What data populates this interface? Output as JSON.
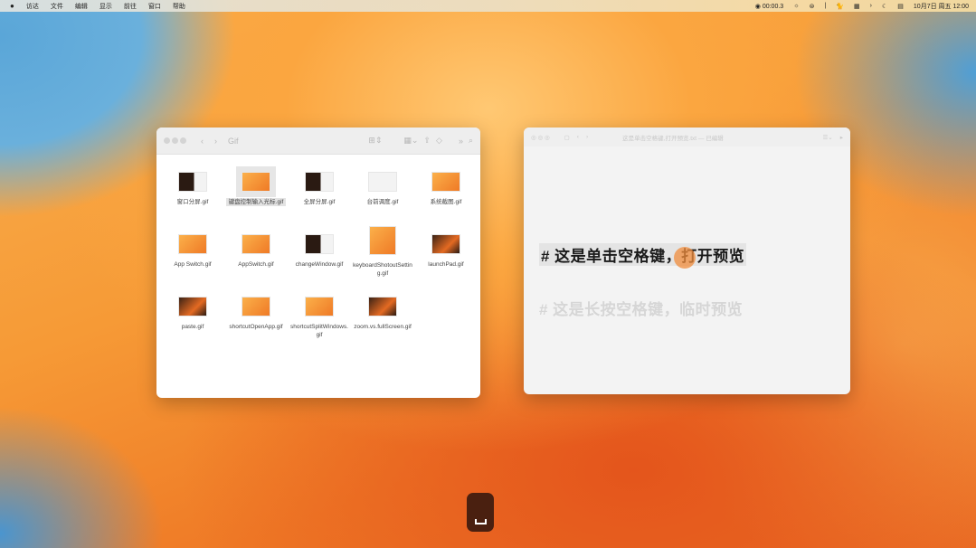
{
  "menubar": {
    "apple": "",
    "items": [
      "访达",
      "文件",
      "编辑",
      "显示",
      "前往",
      "窗口",
      "帮助"
    ],
    "recording": "00:00.3",
    "datetime": "10月7日 周五 12:00"
  },
  "finder": {
    "title": "Gif",
    "items": [
      {
        "name": "窗口分屏.gif",
        "thumb": "dark"
      },
      {
        "name": "键盘控制输入光标.gif",
        "thumb": "orange",
        "selected": true
      },
      {
        "name": "全屏分屏.gif",
        "thumb": "dark"
      },
      {
        "name": "台前调度.gif",
        "thumb": "light"
      },
      {
        "name": "系统截图.gif",
        "thumb": "orange"
      },
      {
        "name": "App Switch.gif",
        "thumb": "orange"
      },
      {
        "name": "AppSwitch.gif",
        "thumb": "orange"
      },
      {
        "name": "changeWindow.gif",
        "thumb": "dark"
      },
      {
        "name": "keyboardShotoutSetting.gif",
        "thumb": "tall"
      },
      {
        "name": "launchPad.gif",
        "thumb": "dark2"
      },
      {
        "name": "paste.gif",
        "thumb": "dark2"
      },
      {
        "name": "shortcutOpenApp.gif",
        "thumb": "orange"
      },
      {
        "name": "shortcutSplitWindows.gif",
        "thumb": "orange"
      },
      {
        "name": "zoom.vs.fullScreen.gif",
        "thumb": "dark2"
      }
    ]
  },
  "preview": {
    "title": "这是单击空格键,打开预览.txt — 已编辑",
    "line1": "#  这是单击空格键，打开预览",
    "line2": "#  这是长按空格键，临时预览"
  },
  "key_indicator": "space"
}
